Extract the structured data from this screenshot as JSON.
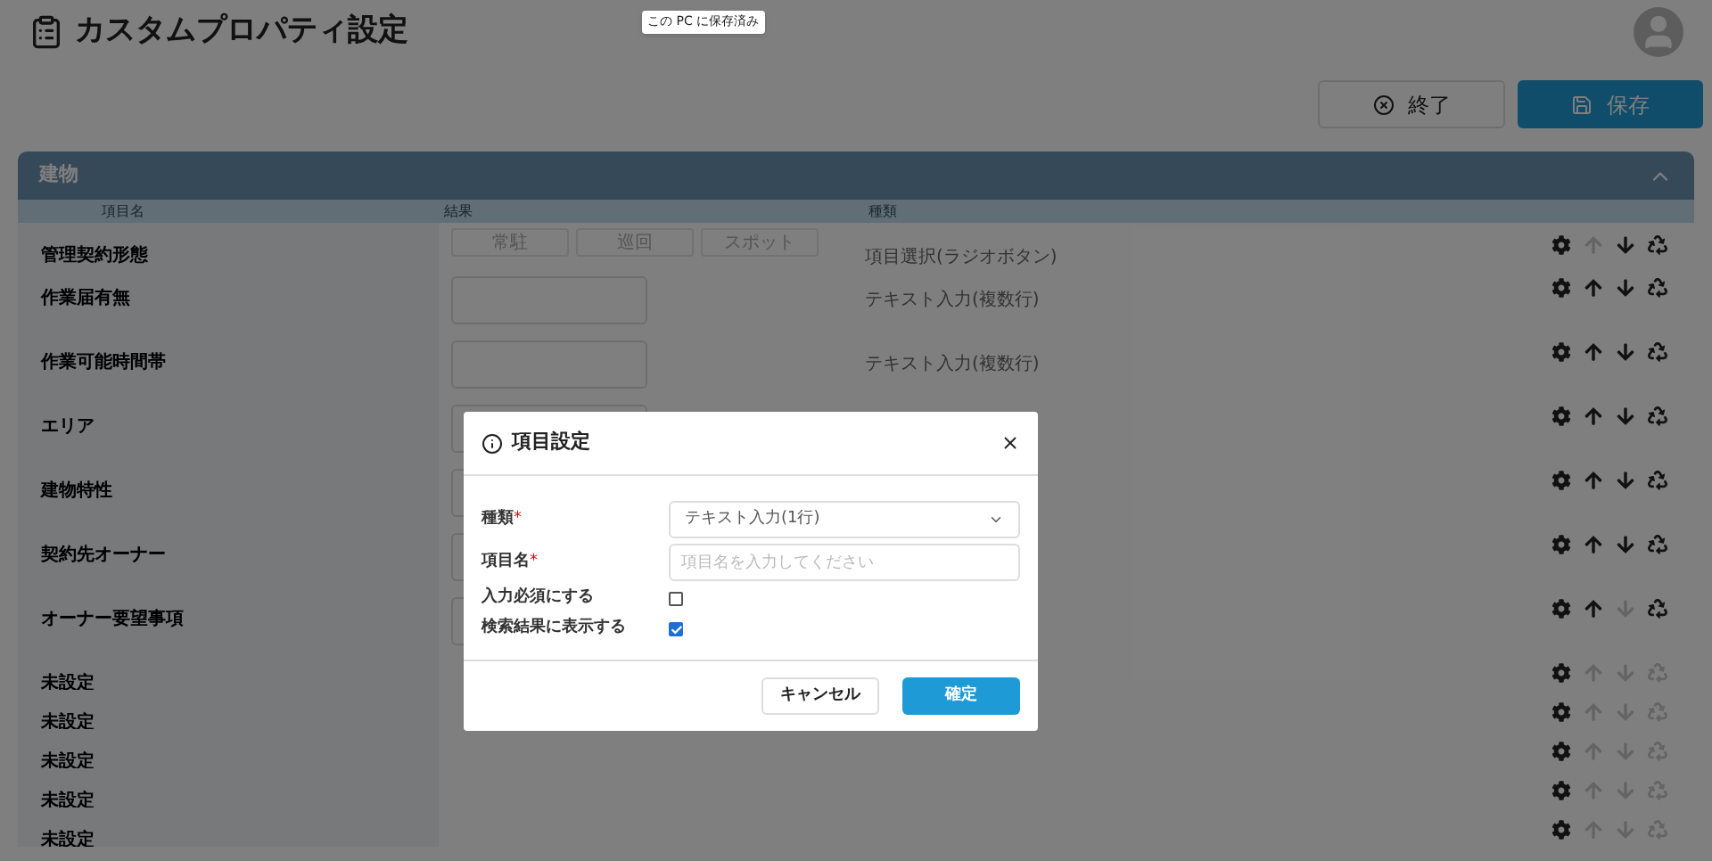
{
  "header": {
    "title": "カスタムプロパティ設定",
    "toast": "この PC に保存済み"
  },
  "buttons": [
    {
      "kind": "close",
      "label": "終了"
    },
    {
      "kind": "save",
      "label": "保存"
    }
  ],
  "panel": {
    "title": "建物",
    "expanded": true,
    "columns": [
      "項目名",
      "結果",
      "種類"
    ],
    "rows": [
      {
        "name": "管理契約形態",
        "kind": "radio",
        "options": [
          "常駐",
          "巡回",
          "スポット"
        ],
        "type": "項目選択(ラジオボタン)",
        "up_enabled": false,
        "down_enabled": true,
        "recycle_enabled": true
      },
      {
        "name": "作業届有無",
        "kind": "textarea",
        "type": "テキスト入力(複数行)",
        "up_enabled": true,
        "down_enabled": true,
        "recycle_enabled": true
      },
      {
        "name": "作業可能時間帯",
        "kind": "textarea",
        "type": "テキスト入力(複数行)",
        "up_enabled": true,
        "down_enabled": true,
        "recycle_enabled": true
      },
      {
        "name": "エリア",
        "kind": "textarea",
        "up_enabled": true,
        "down_enabled": true,
        "recycle_enabled": true
      },
      {
        "name": "建物特性",
        "kind": "textarea",
        "up_enabled": true,
        "down_enabled": true,
        "recycle_enabled": true
      },
      {
        "name": "契約先オーナー",
        "kind": "textarea",
        "up_enabled": true,
        "down_enabled": true,
        "recycle_enabled": true
      },
      {
        "name": "オーナー要望事項",
        "kind": "textarea",
        "up_enabled": true,
        "down_enabled": false,
        "recycle_enabled": true
      },
      {
        "name": "未設定",
        "kind": "none",
        "up_enabled": false,
        "down_enabled": false,
        "recycle_enabled": false
      },
      {
        "name": "未設定",
        "kind": "none",
        "up_enabled": false,
        "down_enabled": false,
        "recycle_enabled": false
      },
      {
        "name": "未設定",
        "kind": "none",
        "up_enabled": false,
        "down_enabled": false,
        "recycle_enabled": false
      },
      {
        "name": "未設定",
        "kind": "none",
        "up_enabled": false,
        "down_enabled": false,
        "recycle_enabled": false
      },
      {
        "name": "未設定",
        "kind": "none",
        "up_enabled": false,
        "down_enabled": false,
        "recycle_enabled": false
      }
    ]
  },
  "dialog": {
    "title": "項目設定",
    "fields": [
      {
        "kind": "select",
        "label": "種類",
        "required_mark": "*",
        "value": "テキスト入力(1行)"
      },
      {
        "kind": "input",
        "label": "項目名",
        "required_mark": "*",
        "placeholder": "項目名を入力してください"
      },
      {
        "kind": "checkbox",
        "label": "入力必須にする",
        "checked": false
      },
      {
        "kind": "checkbox",
        "label": "検索結果に表示する",
        "checked": true
      }
    ],
    "buttons": [
      {
        "kind": "cancel",
        "label": "キャンセル"
      },
      {
        "kind": "confirm",
        "label": "確定"
      }
    ]
  }
}
